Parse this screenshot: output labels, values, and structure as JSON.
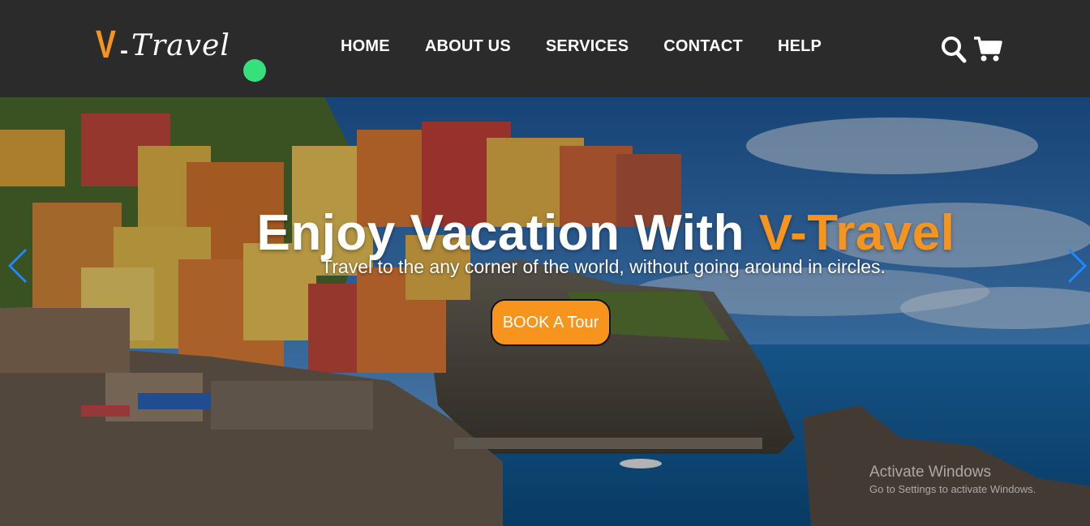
{
  "logo": {
    "letter": "V",
    "dash": "-",
    "text": "Travel"
  },
  "colors": {
    "accent": "#f7941d",
    "navbar": "#2b2b2b",
    "status_dot": "#36e07a",
    "carousel_arrow": "#1e88ff"
  },
  "nav": {
    "items": [
      {
        "label": "HOME"
      },
      {
        "label": "ABOUT US"
      },
      {
        "label": "SERVICES"
      },
      {
        "label": "CONTACT"
      },
      {
        "label": "HELP"
      }
    ],
    "icons": [
      "search-icon",
      "cart-icon"
    ]
  },
  "hero": {
    "title_main": "Enjoy Vacation With",
    "title_accent": "V-Travel",
    "subtitle": "Travel to the any corner of the world, without going around in circles.",
    "cta_label": "BOOK A Tour",
    "icons": [
      "chevron-left-icon",
      "chevron-right-icon"
    ]
  },
  "watermark": {
    "title": "Activate Windows",
    "subtitle": "Go to Settings to activate Windows."
  }
}
